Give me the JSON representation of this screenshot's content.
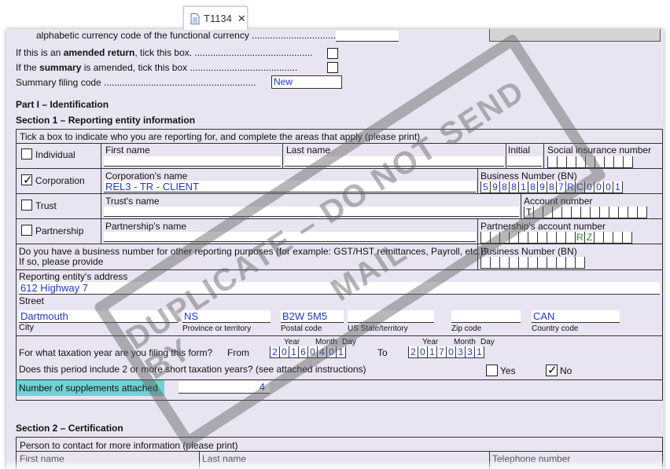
{
  "tab": {
    "title": "T1134",
    "icon": "document-icon",
    "close": "✕"
  },
  "top": {
    "currency_text": "alphabetic currency code of the functional currency",
    "amended_return_prefix": "If this is an ",
    "amended_return_bold": "amended return",
    "amended_return_suffix": ", tick this box.",
    "summary_prefix": "If the ",
    "summary_bold": "summary",
    "summary_suffix": " is amended, tick this box",
    "filing_code_label": "Summary filing code",
    "filing_code_value": "New"
  },
  "part1": {
    "title": "Part I – Identification",
    "section1": "Section 1 – Reporting entity information"
  },
  "section1": {
    "instructions": "Tick a box to indicate who you are reporting for, and complete the areas that apply (please print)",
    "individual": {
      "label": "Individual",
      "first_name": "First name",
      "last_name": "Last name",
      "initial": "Initial",
      "sin": "Social insurance number"
    },
    "corporation": {
      "label": "Corporation",
      "checked": true,
      "name_label": "Corporation's name",
      "name_value": "REL3 - TR - CLIENT",
      "bn_label": "Business Number (BN)",
      "bn_digits": [
        "5",
        "9",
        "8",
        "8",
        "1",
        "8",
        "9",
        "8",
        "7",
        "R",
        "C",
        "0",
        "0",
        "0",
        "1"
      ]
    },
    "trust": {
      "label": "Trust",
      "name_label": "Trust's name",
      "account_label": "Account number",
      "account_prefix": "T"
    },
    "partnership": {
      "label": "Partnership",
      "name_label": "Partnership's name",
      "account_label": "Partnership's account number",
      "account_digits": [
        "R",
        "Z"
      ]
    },
    "other_bn": {
      "question": "Do you have a business number for other reporting purposes (for example: GST/HST remittances, Payroll, etc.)?",
      "question2": "If so, please provide",
      "bn_label": "Business Number (BN)"
    },
    "address": {
      "label": "Reporting entity's address",
      "value": "612 Highway 7",
      "street": "Street",
      "city": "Dartmouth",
      "city_label": "City",
      "province": "NS",
      "province_label": "Province or territory",
      "postal": "B2W 5M5",
      "postal_label": "Postal code",
      "state_label": "US State/territory",
      "zip_label": "Zip code",
      "country": "CAN",
      "country_label": "Country code"
    },
    "taxyear": {
      "question": "For what taxation year are you filing this form?",
      "from_label": "From",
      "to_label": "To",
      "year": "Year",
      "month": "Month",
      "day": "Day",
      "from_digits": [
        "2",
        "0",
        "1",
        "6",
        "0",
        "4",
        "0",
        "1"
      ],
      "to_digits": [
        "2",
        "0",
        "1",
        "7",
        "0",
        "3",
        "3",
        "1"
      ]
    },
    "short_years": {
      "question": "Does this period include 2 or more short taxation years? (see attached instructions)",
      "yes": "Yes",
      "no": "No",
      "no_checked": true
    },
    "supplements": {
      "label": "Number of supplements attached",
      "value": "4"
    }
  },
  "section2": {
    "title": "Section 2 – Certification",
    "contact": "Person to contact for more information (please print)",
    "first_name": "First name",
    "last_name": "Last name",
    "telephone": "Telephone number"
  },
  "watermark": {
    "line1": "DUPLICATE – DO NOT SEND BY",
    "line2": "MAIL"
  }
}
